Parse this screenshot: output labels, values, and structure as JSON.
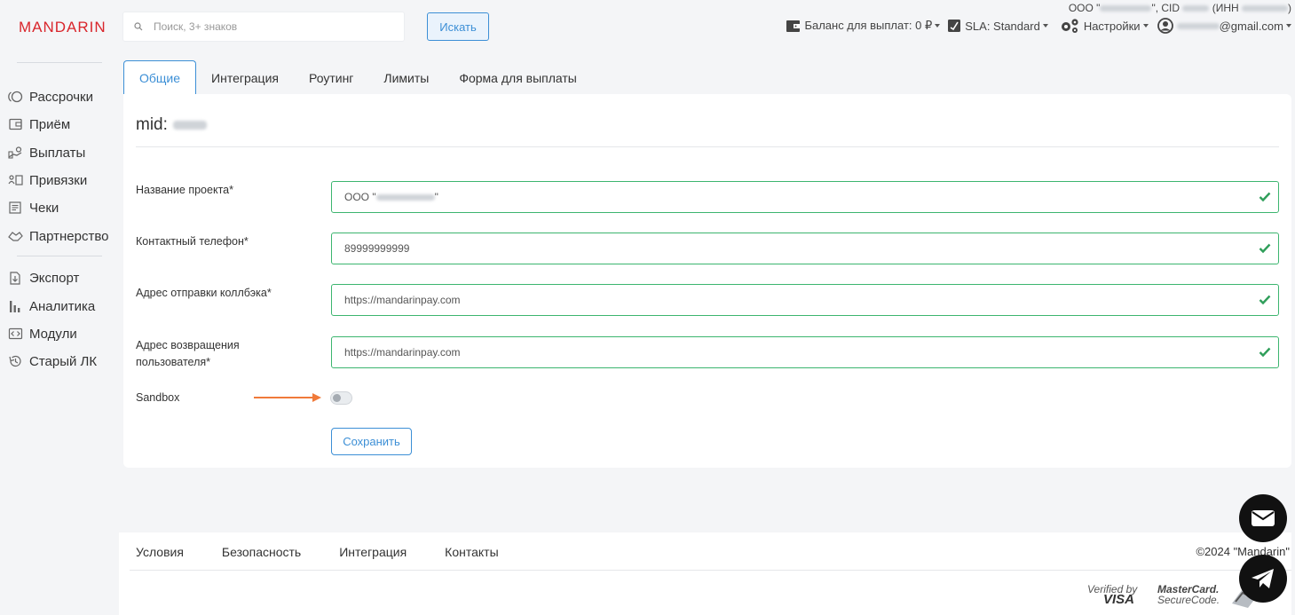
{
  "brand": {
    "logo": "MANDARIN",
    "accent": "#d9262c",
    "primary": "#3c8fd6",
    "success": "#3cb56f"
  },
  "header": {
    "search_placeholder": "Поиск, 3+ знаков",
    "search_button": "Искать",
    "company": {
      "prefix": "ООО \"",
      "cid": "\", CID ",
      "inn": " (ИНН ",
      "suffix": ")"
    },
    "balance": "Баланс для выплат: 0 ₽",
    "sla": "SLA: Standard",
    "settings": "Настройки",
    "email_suffix": "@gmail.com"
  },
  "sidebar": {
    "items": [
      {
        "label": "Рассрочки",
        "icon": "installment-icon"
      },
      {
        "label": "Приём",
        "icon": "wallet-icon"
      },
      {
        "label": "Выплаты",
        "icon": "payout-icon"
      },
      {
        "label": "Привязки",
        "icon": "card-link-icon"
      },
      {
        "label": "Чеки",
        "icon": "receipt-icon"
      },
      {
        "label": "Партнерство",
        "icon": "handshake-icon"
      },
      {
        "label": "Экспорт",
        "icon": "export-icon"
      },
      {
        "label": "Аналитика",
        "icon": "analytics-icon"
      },
      {
        "label": "Модули",
        "icon": "modules-icon"
      },
      {
        "label": "Старый ЛК",
        "icon": "history-icon"
      }
    ]
  },
  "tabs": [
    "Общие",
    "Интеграция",
    "Роутинг",
    "Лимиты",
    "Форма для выплаты"
  ],
  "form": {
    "mid_label": "mid:",
    "fields": [
      {
        "label": "Название проекта*",
        "value_prefix": "ООО \"",
        "value_suffix": "\""
      },
      {
        "label": "Контактный телефон*",
        "value": "89999999999"
      },
      {
        "label": "Адрес отправки коллбэка*",
        "value": "https://mandarinpay.com"
      },
      {
        "label_line1": "Адрес возвращения",
        "label_line2": "пользователя*",
        "value": "https://mandarinpay.com"
      }
    ],
    "sandbox_label": "Sandbox",
    "sandbox_enabled": false,
    "save_button": "Сохранить"
  },
  "footer": {
    "links": [
      "Условия",
      "Безопасность",
      "Интеграция",
      "Контакты"
    ],
    "copyright": "©2024 \"Mandarin\"",
    "payment_logos": {
      "visa_top": "Verified by",
      "visa_bottom": "VISA",
      "mc_top": "MasterCard.",
      "mc_bottom": "SecureCode."
    }
  }
}
